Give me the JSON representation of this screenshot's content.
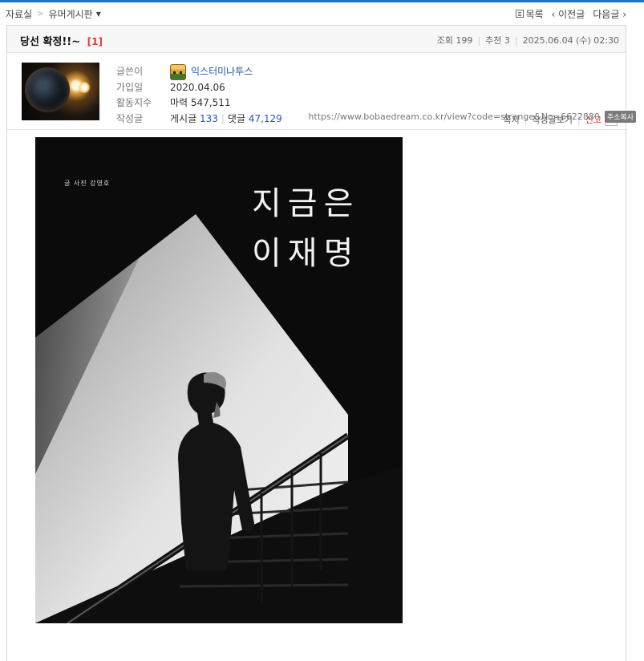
{
  "breadcrumb": {
    "root": "자료실",
    "separator": ">",
    "board": "유머게시판",
    "dropdown_arrow": "▼"
  },
  "top_nav": {
    "list_label": "목록",
    "prev_label": "‹ 이전글",
    "next_label": "다음글 ›"
  },
  "post": {
    "title": "당선 확정!!~",
    "comment_count": "[1]",
    "views_label": "조회",
    "views": "199",
    "recommend_label": "추천",
    "recommend": "3",
    "date": "2025.06.04 (수) 02:30"
  },
  "author": {
    "labels": {
      "writer": "글쓴이",
      "joined": "가입일",
      "activity": "활동지수",
      "posts": "작성글"
    },
    "nickname": "익스터미나투스",
    "joined": "2020.04.06",
    "activity_label": "마력",
    "activity_value": "547,511",
    "posts_label": "게시글",
    "posts_count": "133",
    "comments_label": "댓글",
    "comments_count": "47,129"
  },
  "actions": {
    "message": "쪽지",
    "view_posts": "작성글보기",
    "report": "신고",
    "more_arrow": "▼"
  },
  "url": {
    "text": "https://www.bobaedream.co.kr/view?code=strange&No=6622880",
    "copy_label": "주소복사"
  },
  "poster": {
    "credit": "글 사진 강영호",
    "title_line1": "지금은",
    "title_line2": "이재명"
  },
  "colors": {
    "accent": "#1a73c6",
    "link_blue": "#2255cc",
    "report_red": "#d9352b",
    "comment_red": "#e53935"
  }
}
